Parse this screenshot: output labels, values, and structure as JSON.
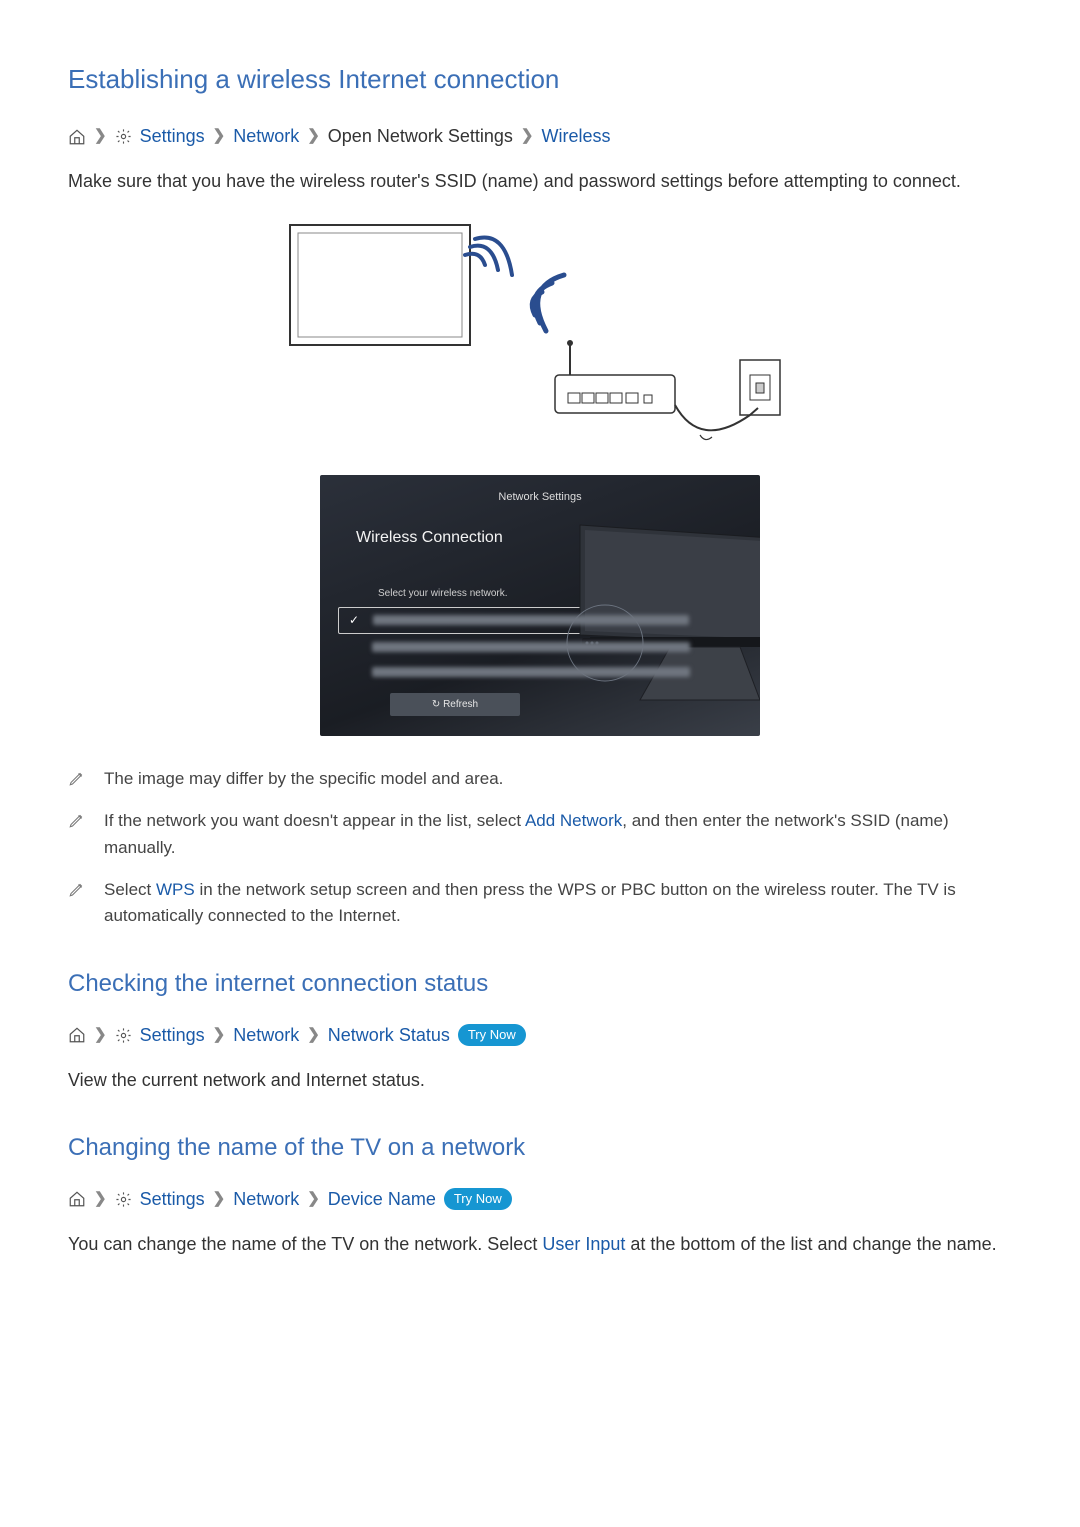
{
  "section1": {
    "title": "Establishing a wireless Internet connection",
    "breadcrumb": {
      "settings": "Settings",
      "network": "Network",
      "open_network": "Open Network Settings",
      "wireless": "Wireless"
    },
    "intro": "Make sure that you have the wireless router's SSID (name) and password settings before attempting to connect."
  },
  "screenshot": {
    "title": "Network Settings",
    "heading": "Wireless Connection",
    "subtitle": "Select your wireless network.",
    "refresh": "↻ Refresh"
  },
  "notes": {
    "n1": "The image may differ by the specific model and area.",
    "n2_a": "If the network you want doesn't appear in the list, select ",
    "n2_link": "Add Network",
    "n2_b": ", and then enter the network's SSID (name) manually.",
    "n3_a": "Select ",
    "n3_link": "WPS",
    "n3_b": " in the network setup screen and then press the WPS or PBC button on the wireless router. The TV is automatically connected to the Internet."
  },
  "section2": {
    "title": "Checking the internet connection status",
    "breadcrumb": {
      "settings": "Settings",
      "network": "Network",
      "status": "Network Status"
    },
    "try_now": "Try Now",
    "para": "View the current network and Internet status."
  },
  "section3": {
    "title": "Changing the name of the TV on a network",
    "breadcrumb": {
      "settings": "Settings",
      "network": "Network",
      "device": "Device Name"
    },
    "try_now": "Try Now",
    "para_a": "You can change the name of the TV on the network. Select ",
    "para_link": "User Input",
    "para_b": " at the bottom of the list and change the name."
  }
}
